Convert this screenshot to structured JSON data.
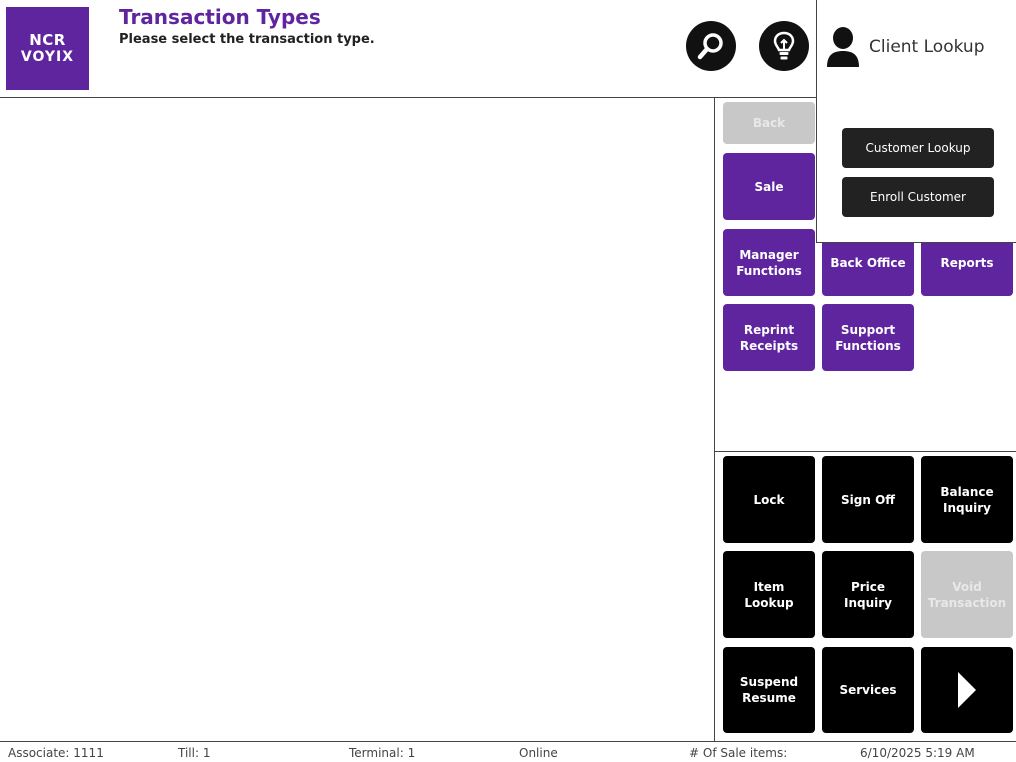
{
  "header": {
    "logo_line1": "NCR",
    "logo_line2": "VOYIX",
    "title": "Transaction Types",
    "subtitle": "Please select the transaction type.",
    "search_icon": "search-icon",
    "idea_icon": "lightbulb-icon"
  },
  "client_menu": {
    "label": "Client Lookup",
    "icon": "user-icon",
    "items": [
      "Customer Lookup",
      "Enroll Customer"
    ]
  },
  "transaction_buttons": {
    "back": "Back",
    "sale": "Sale",
    "manager_functions": "Manager Functions",
    "back_office": "Back Office",
    "reports": "Reports",
    "reprint_receipts": "Reprint Receipts",
    "support_functions": "Support Functions"
  },
  "quick_buttons": {
    "lock": "Lock",
    "sign_off": "Sign Off",
    "balance_inquiry": "Balance Inquiry",
    "item_lookup": "Item Lookup",
    "price_inquiry": "Price Inquiry",
    "void_transaction": "Void Transaction",
    "suspend_resume": "Suspend Resume",
    "services": "Services",
    "next_icon": "arrow-right-icon"
  },
  "status_bar": {
    "associate": "Associate: 1111",
    "till": "Till: 1",
    "terminal": "Terminal: 1",
    "connection": "Online",
    "sale_items": "# Of Sale items:",
    "datetime": "6/10/2025 5:19 AM"
  },
  "colors": {
    "brand_purple": "#5f259f",
    "dark": "#000000",
    "disabled": "#c8c8c8"
  }
}
